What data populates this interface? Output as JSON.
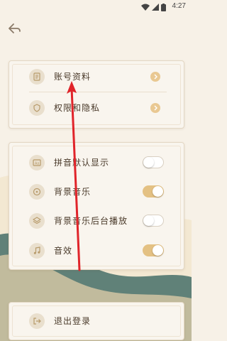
{
  "status": {
    "time": "4:27"
  },
  "account_section": {
    "items": [
      {
        "label": "账号资料",
        "icon": "document-icon"
      },
      {
        "label": "权限和隐私",
        "icon": "shield-icon"
      }
    ]
  },
  "settings_section": {
    "items": [
      {
        "label": "拼音默认显示",
        "icon": "pinyin-icon",
        "toggle_on": false
      },
      {
        "label": "背景音乐",
        "icon": "music-disc-icon",
        "toggle_on": true
      },
      {
        "label": "背景音乐后台播放",
        "icon": "layers-icon",
        "toggle_on": false
      },
      {
        "label": "音效",
        "icon": "music-note-icon",
        "toggle_on": true
      }
    ]
  },
  "logout_section": {
    "label": "退出登录",
    "icon": "logout-icon"
  },
  "colors": {
    "accent": "#e4c183",
    "annotation": "#e0242a",
    "text": "#4a3a2a"
  }
}
